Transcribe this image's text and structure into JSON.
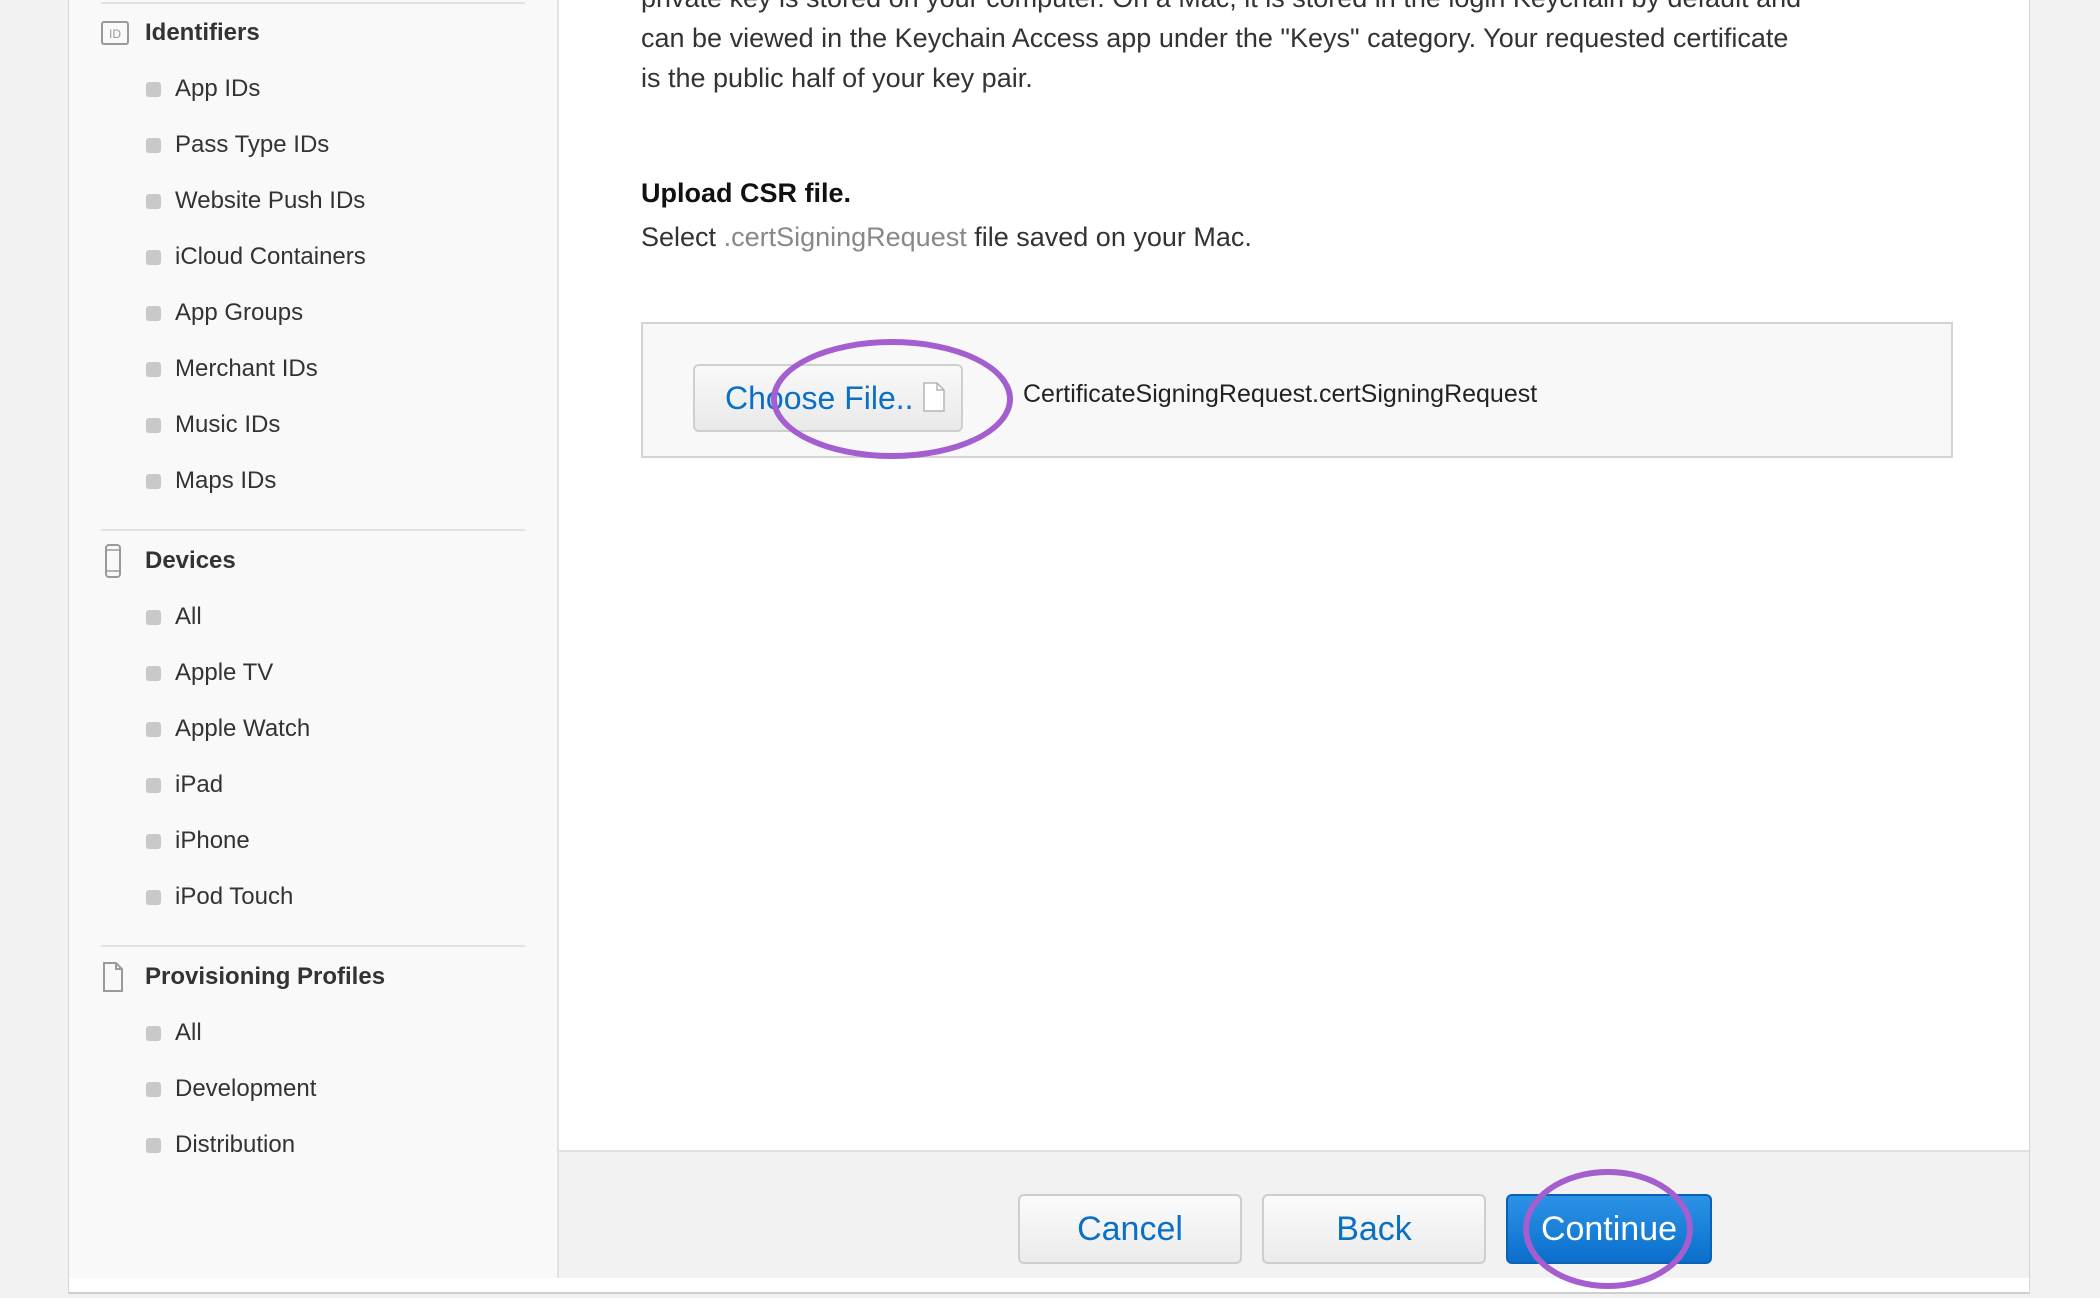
{
  "sidebar": {
    "identifiers": {
      "heading": "Identifiers",
      "icon": "id-badge-icon",
      "items": [
        "App IDs",
        "Pass Type IDs",
        "Website Push IDs",
        "iCloud Containers",
        "App Groups",
        "Merchant IDs",
        "Music IDs",
        "Maps IDs"
      ]
    },
    "devices": {
      "heading": "Devices",
      "icon": "phone-device-icon",
      "items": [
        "All",
        "Apple TV",
        "Apple Watch",
        "iPad",
        "iPhone",
        "iPod Touch"
      ]
    },
    "profiles": {
      "heading": "Provisioning Profiles",
      "icon": "document-icon",
      "items": [
        "All",
        "Development",
        "Distribution"
      ]
    }
  },
  "main": {
    "intro_lines": [
      "private key is stored on your computer. On a Mac, it is stored in the login Keychain by default and",
      "can be viewed in the Keychain Access app under the \"Keys\" category. Your requested certificate",
      "is the public half of your key pair."
    ],
    "upload_title": "Upload CSR file.",
    "upload_desc_prefix": "Select",
    "upload_desc_ext": ".certSigningRequest",
    "upload_desc_suffix": "file saved on your Mac.",
    "choose_file_label": "Choose File..",
    "file_name": "CertificateSigningRequest.certSigningRequest"
  },
  "footer": {
    "cancel_label": "Cancel",
    "back_label": "Back",
    "continue_label": "Continue"
  },
  "colors": {
    "link_blue": "#0a70c6",
    "primary_blue": "#1a7fd8",
    "annotation_purple": "#a45ed0"
  }
}
